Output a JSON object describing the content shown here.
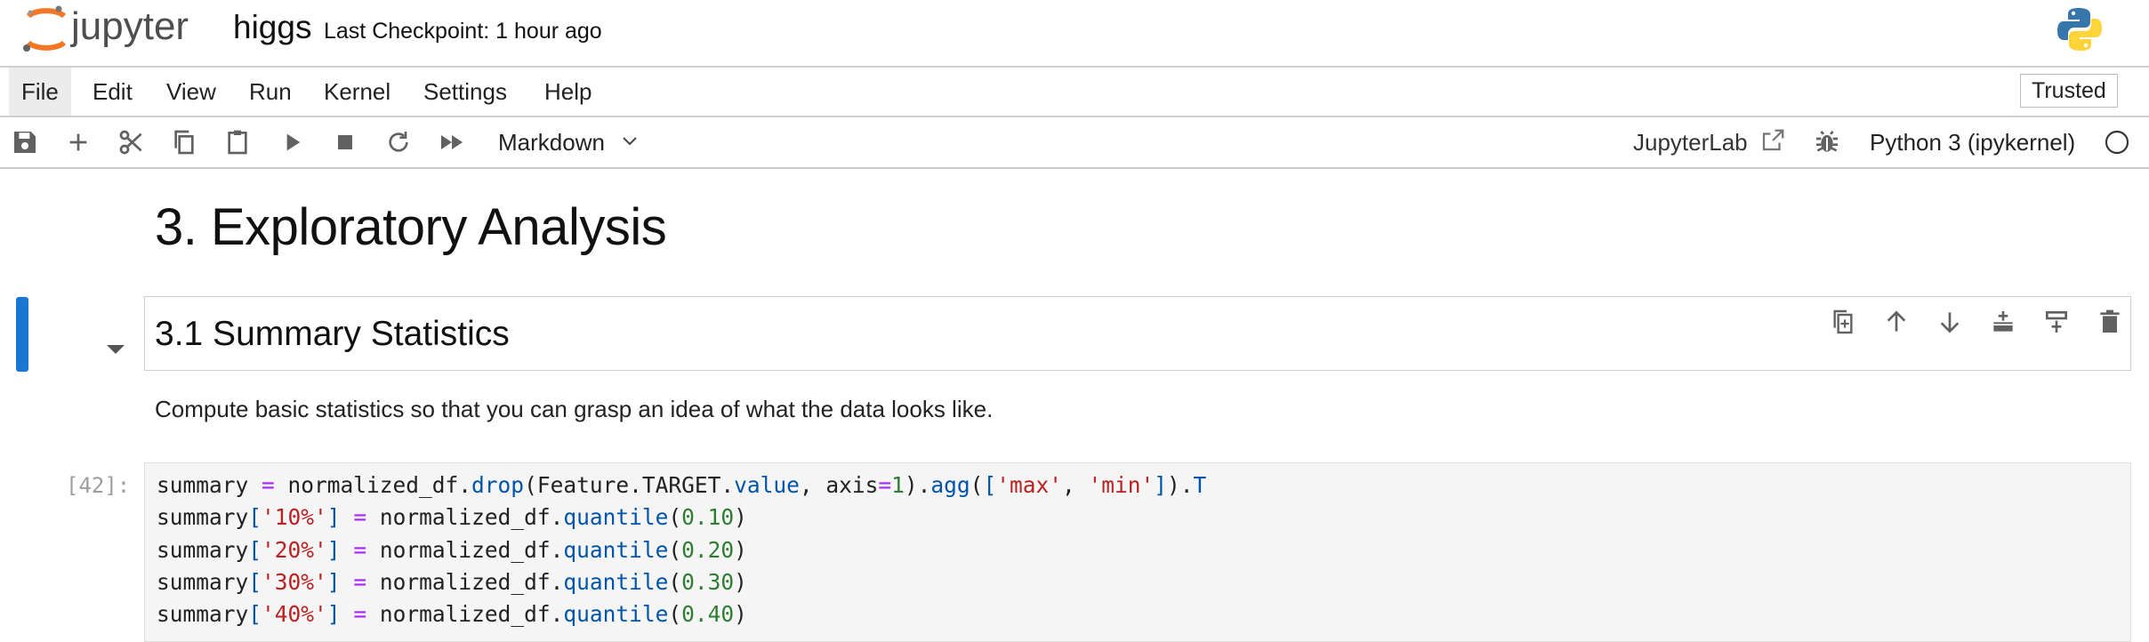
{
  "header": {
    "app_name": "jupyter",
    "notebook_name": "higgs",
    "checkpoint": "Last Checkpoint: 1 hour ago"
  },
  "menu": {
    "items": [
      "File",
      "Edit",
      "View",
      "Run",
      "Kernel",
      "Settings",
      "Help"
    ],
    "active": "File",
    "trusted": "Trusted"
  },
  "toolbar": {
    "icons": [
      "save-icon",
      "add-cell-icon",
      "cut-icon",
      "copy-icon",
      "paste-icon",
      "run-icon",
      "stop-icon",
      "restart-icon",
      "fast-forward-icon"
    ],
    "cell_type": "Markdown",
    "jupyterlab_label": "JupyterLab",
    "kernel_name": "Python 3 (ipykernel)",
    "kernel_status": "idle"
  },
  "notebook": {
    "heading1": "3. Exploratory Analysis",
    "heading2": "3.1 Summary Statistics",
    "paragraph": "Compute basic statistics so that you can grasp an idea of what the data looks like.",
    "cell_actions": [
      "duplicate-cell-icon",
      "move-up-icon",
      "move-down-icon",
      "insert-above-icon",
      "insert-below-icon",
      "delete-cell-icon"
    ],
    "code_cell": {
      "prompt": "[42]:",
      "lines": [
        "summary = normalized_df.drop(Feature.TARGET.value, axis=1).agg(['max', 'min']).T",
        "summary['10%'] = normalized_df.quantile(0.10)",
        "summary['20%'] = normalized_df.quantile(0.20)",
        "summary['30%'] = normalized_df.quantile(0.30)",
        "summary['40%'] = normalized_df.quantile(0.40)"
      ]
    }
  },
  "colors": {
    "accent": "#1976d2",
    "jupyter_orange": "#f37726",
    "keyword_purple": "#aa22ff",
    "function_blue": "#0055aa",
    "number_green": "#2e7d32",
    "string_red": "#ba2121"
  }
}
